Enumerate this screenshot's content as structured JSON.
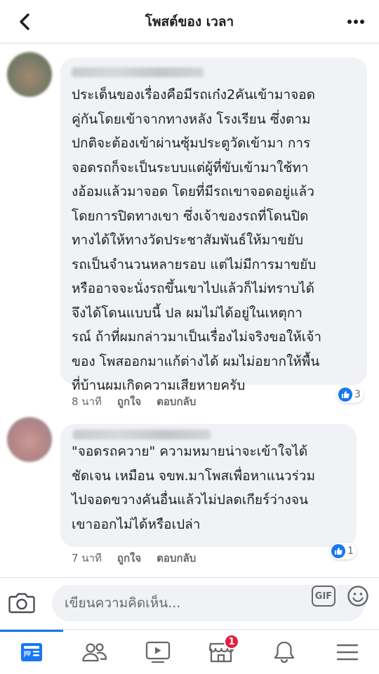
{
  "header": {
    "title": "โพสต์ของ เวลา"
  },
  "comments": [
    {
      "text": "ประเด็นของเรื่องคือมีรถเก๋ง2คันเข้ามาจอด\nคู่กันโดยเข้าจากทางหลัง โรงเรียน ซึ่งตาม\nปกติจะต้องเข้าผ่านซุ้มประตูวัดเข้ามา การ\nจอดรถก็จะเป็นระบบแต่ผู้ที่ขับเข้ามาใช้ทา\nงอ้อมแล้วมาจอด โดยที่มีรถเขาจอดอยู่แล้ว\nโดยการปิดทางเขา ซึ่งเจ้าของรถที่โดนปิด\nทางได้ให้ทางวัดประชาสัมพันธ์ให้มาขยับ\nรถเป็นจำนวนหลายรอบ แต่ไม่มีการมาขยับ\nหรืออาจจะนั่งรถขึ้นเขาไปแล้วก็ไม่ทราบได้\nจึงได้โดนแบบนี้ ปล ผมไม่ได้อยู่ในเหตุกา\nรณ์ ถ้าที่ผมกล่าวมาเป็นเรื่องไม่จริงขอให้เจ้า\nของ โพสออกมาแก้ต่างได้ ผมไม่อยากให้พื้น\nที่บ้านผมเกิดความเสียหายครับ",
      "time": "8 นาที",
      "like_label": "ถูกใจ",
      "reply_label": "ตอบกลับ",
      "reaction_count": "3"
    },
    {
      "text": "\"จอดรถควาย\" ความหมายน่าจะเข้าใจได้\nชัดเจน เหมือน จขพ.มาโพสเพื่อหาแนวร่วม\nไปจอดขวางคันอื่นแล้วไม่ปลดเกียร์ว่างจน\nเขาออกไม่ได้หรือเปล่า",
      "time": "7 นาที",
      "like_label": "ถูกใจ",
      "reply_label": "ตอบกลับ",
      "reaction_count": "1"
    }
  ],
  "composer": {
    "placeholder": "เขียนความคิดเห็น...",
    "gif_label": "GIF"
  },
  "bottom_nav": {
    "marketplace_badge": "1"
  },
  "colors": {
    "accent": "#1877f2",
    "badge": "#e41e3f",
    "bubble": "#f0f2f5",
    "secondary_text": "#65676b"
  }
}
